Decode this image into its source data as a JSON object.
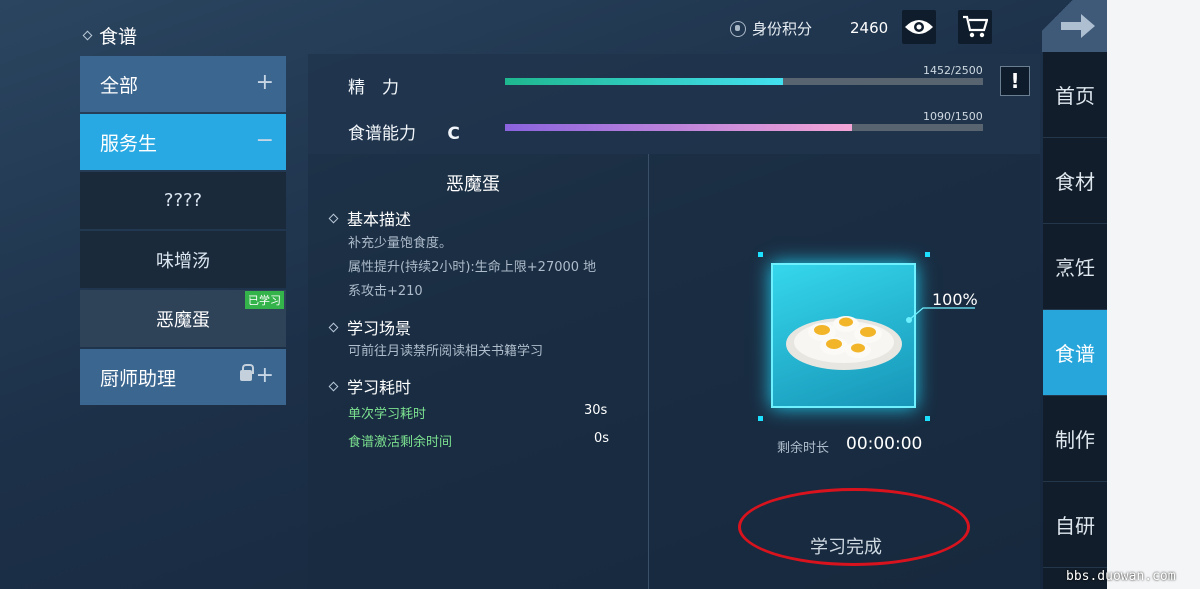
{
  "header": {
    "title": "食谱",
    "id_points_label": "身份积分",
    "id_points_value": "2460"
  },
  "categories": [
    {
      "label": "全部",
      "sign": "+"
    },
    {
      "label": "服务生",
      "sign": "−"
    },
    {
      "label": "????"
    },
    {
      "label": "味增汤"
    },
    {
      "label": "恶魔蛋",
      "badge": "已学习"
    },
    {
      "label": "厨师助理",
      "sign": "+"
    }
  ],
  "stats": {
    "energy": {
      "label": "精　力",
      "value": "1452/2500",
      "fraction": 0.5808,
      "color_start": "#1fb78f",
      "color_end": "#43e0f0"
    },
    "skill": {
      "label": "食谱能力",
      "grade": "C",
      "value": "1090/1500",
      "fraction": 0.7267,
      "color_start": "#8a63de",
      "color_end": "#f3a5d6"
    }
  },
  "recipe": {
    "name": "恶魔蛋",
    "basic_title": "基本描述",
    "basic_lines": [
      "补充少量饱食度。",
      "属性提升(持续2小时):生命上限+27000 地",
      "系攻击+210"
    ],
    "scene_title": "学习场景",
    "scene_text": "可前往月读禁所阅读相关书籍学习",
    "time_title": "学习耗时",
    "single_label": "单次学习耗时",
    "single_value": "30s",
    "activate_label": "食谱激活剩余时间",
    "activate_value": "0s"
  },
  "study": {
    "progress": "100%",
    "remain_label": "剩余时长",
    "remain_time": "00:00:00",
    "complete_label": "学习完成"
  },
  "nav": [
    "首页",
    "食材",
    "烹饪",
    "食谱",
    "制作",
    "自研"
  ],
  "watermark": "bbs.duowan.com",
  "icons": {
    "eye": "eye-icon",
    "cart": "cart-icon",
    "back": "arrow-right-icon",
    "warn": "exclamation-icon"
  }
}
